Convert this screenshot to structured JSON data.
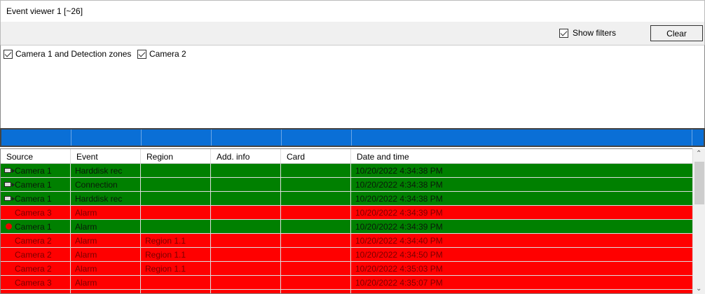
{
  "title": "Event viewer 1 [~26]",
  "toolbar": {
    "show_filters_label": "Show filters",
    "show_filters_checked": true,
    "clear_label": "Clear"
  },
  "filters": [
    {
      "label": "Camera 1 and Detection zones",
      "checked": true
    },
    {
      "label": "Camera 2",
      "checked": true
    }
  ],
  "columns": [
    "Source",
    "Event",
    "Region",
    "Add. info",
    "Card",
    "Date and time"
  ],
  "rows": [
    {
      "source": "Camera 1",
      "event": "Harddisk rec",
      "region": "",
      "info": "",
      "card": "",
      "time": "10/20/2022 4:34:38 PM",
      "color": "green",
      "icon": "camera-icon"
    },
    {
      "source": "Camera 1",
      "event": "Connection",
      "region": "",
      "info": "",
      "card": "",
      "time": "10/20/2022 4:34:38 PM",
      "color": "green",
      "icon": "camera-icon"
    },
    {
      "source": "Camera 1",
      "event": "Harddisk rec",
      "region": "",
      "info": "",
      "card": "",
      "time": "10/20/2022 4:34:38 PM",
      "color": "green",
      "icon": "camera-icon"
    },
    {
      "source": "Camera 3",
      "event": "Alarm",
      "region": "",
      "info": "",
      "card": "",
      "time": "10/20/2022 4:34:39 PM",
      "color": "red",
      "icon": ""
    },
    {
      "source": "Camera 1",
      "event": "Alarm",
      "region": "",
      "info": "",
      "card": "",
      "time": "10/20/2022 4:34:39 PM",
      "color": "green",
      "icon": "red-dot-icon"
    },
    {
      "source": "Camera 2",
      "event": "Alarm",
      "region": "Region 1.1",
      "info": "",
      "card": "",
      "time": "10/20/2022 4:34:40 PM",
      "color": "red",
      "icon": ""
    },
    {
      "source": "Camera 2",
      "event": "Alarm",
      "region": "Region 1.1",
      "info": "",
      "card": "",
      "time": "10/20/2022 4:34:50 PM",
      "color": "red",
      "icon": ""
    },
    {
      "source": "Camera 2",
      "event": "Alarm",
      "region": "Region 1.1",
      "info": "",
      "card": "",
      "time": "10/20/2022 4:35:03 PM",
      "color": "red",
      "icon": ""
    },
    {
      "source": "Camera 3",
      "event": "Alarm",
      "region": "",
      "info": "",
      "card": "",
      "time": "10/20/2022 4:35:07 PM",
      "color": "red",
      "icon": ""
    },
    {
      "source": "",
      "event": "",
      "region": "",
      "info": "",
      "card": "",
      "time": "",
      "color": "red",
      "icon": ""
    }
  ]
}
